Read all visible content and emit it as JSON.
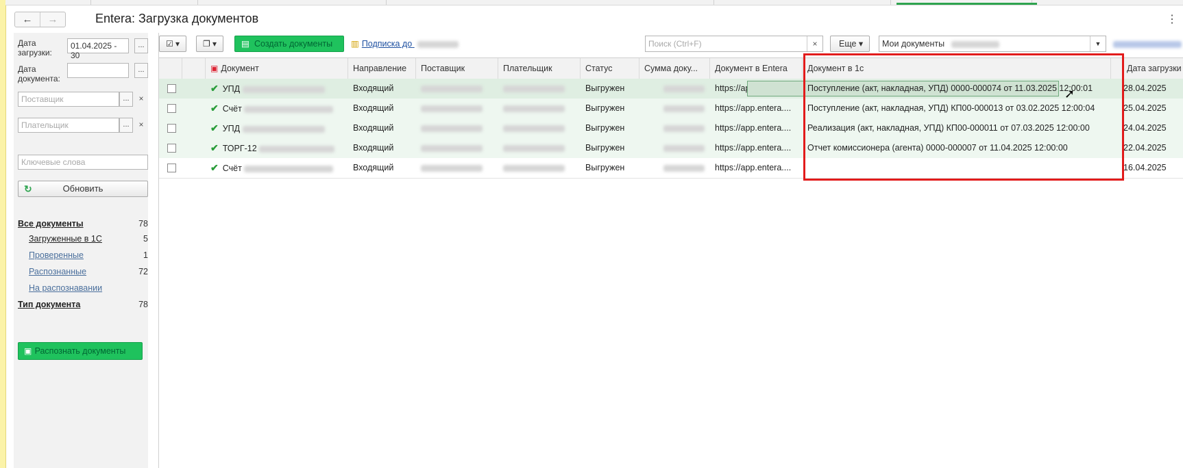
{
  "nav": {
    "back": "←",
    "forward": "→"
  },
  "title": "Entera: Загрузка документов",
  "menu_kebab": "⋮",
  "filters": {
    "upload_date_label": "Дата загрузки:",
    "upload_date_value": "01.04.2025 - 30",
    "doc_date_label": "Дата документа:",
    "doc_date_value": "",
    "supplier_placeholder": "Поставщик",
    "payer_placeholder": "Плательщик",
    "keywords_placeholder": "Ключевые слова",
    "dots": "...",
    "clear": "×",
    "refresh_label": "Обновить"
  },
  "sidebar": {
    "items": [
      {
        "label": "Все документы",
        "count": "78"
      },
      {
        "label": "Загруженные в 1С",
        "count": "5"
      },
      {
        "label": "Проверенные",
        "count": "1"
      },
      {
        "label": "Распознанные",
        "count": "72"
      },
      {
        "label": "На распознавании",
        "count": ""
      },
      {
        "label": "Тип документа",
        "count": "78"
      }
    ],
    "recognize_button": "Распознать документы"
  },
  "toolbar": {
    "create_label": "Создать документы",
    "subscription_label": "Подписка до",
    "search_placeholder": "Поиск (Ctrl+F)",
    "search_clear": "×",
    "more_label": "Еще",
    "filter_select_value": "Мои документы"
  },
  "table": {
    "columns": [
      "Документ",
      "Направление",
      "Поставщик",
      "Плательщик",
      "Статус",
      "Сумма доку...",
      "Документ в Entera",
      "Документ в 1с",
      "Дата загрузки"
    ],
    "rows": [
      {
        "doc": "УПД",
        "direction": "Входящий",
        "status": "Выгружен",
        "entera": "https://app.entera....",
        "doc1c": "Поступление (акт, накладная, УПД) 0000-000074 от 11.03.2025 12:00:01",
        "date": "28.04.2025"
      },
      {
        "doc": "Счёт",
        "direction": "Входящий",
        "status": "Выгружен",
        "entera": "https://app.entera....",
        "doc1c": "Поступление (акт, накладная, УПД) КП00-000013 от 03.02.2025 12:00:04",
        "date": "25.04.2025"
      },
      {
        "doc": "УПД",
        "direction": "Входящий",
        "status": "Выгружен",
        "entera": "https://app.entera....",
        "doc1c": "Реализация (акт, накладная, УПД) КП00-000011 от 07.03.2025 12:00:00",
        "date": "24.04.2025"
      },
      {
        "doc": "ТОРГ-12",
        "direction": "Входящий",
        "status": "Выгружен",
        "entera": "https://app.entera....",
        "doc1c": "Отчет комиссионера (агента) 0000-000007 от 11.04.2025 12:00:00",
        "date": "22.04.2025"
      },
      {
        "doc": "Счёт",
        "direction": "Входящий",
        "status": "Выгружен",
        "entera": "https://app.entera....",
        "doc1c": "",
        "date": "16.04.2025"
      }
    ]
  },
  "colors": {
    "accent_green": "#1fc25d",
    "highlight_red": "#e21b1b",
    "row_green": "#e8f4ea"
  }
}
